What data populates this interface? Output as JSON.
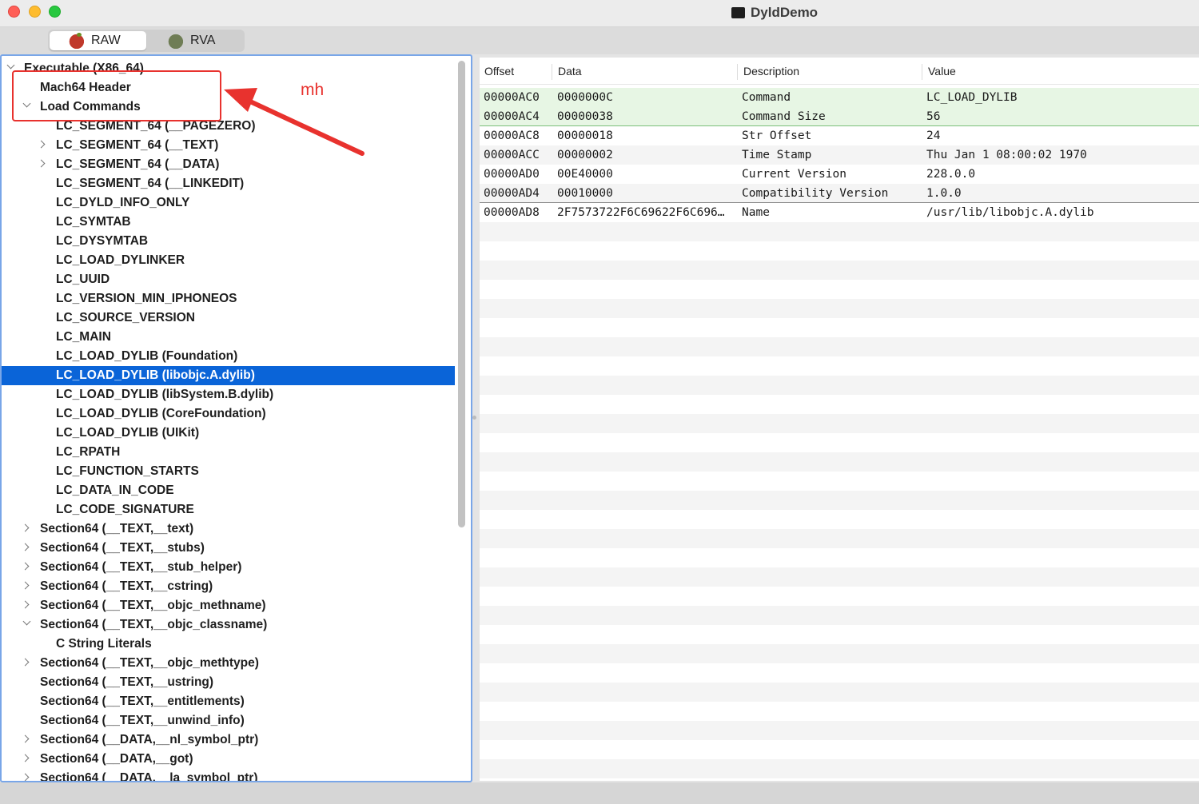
{
  "window": {
    "title": "DyldDemo"
  },
  "toolbar": {
    "modes": [
      {
        "label": "RAW",
        "icon": "apple-icon",
        "selected": true
      },
      {
        "label": "RVA",
        "icon": "bug-icon",
        "selected": false
      }
    ]
  },
  "tree": {
    "items": [
      {
        "label": "Executable  (X86_64)",
        "level": 0,
        "expander": "down",
        "selected": false
      },
      {
        "label": "Mach64 Header",
        "level": 1,
        "expander": "none",
        "selected": false
      },
      {
        "label": "Load Commands",
        "level": 1,
        "expander": "down",
        "selected": false
      },
      {
        "label": "LC_SEGMENT_64 (__PAGEZERO)",
        "level": 2,
        "expander": "none",
        "selected": false
      },
      {
        "label": "LC_SEGMENT_64 (__TEXT)",
        "level": 2,
        "expander": "right",
        "selected": false
      },
      {
        "label": "LC_SEGMENT_64 (__DATA)",
        "level": 2,
        "expander": "right",
        "selected": false
      },
      {
        "label": "LC_SEGMENT_64 (__LINKEDIT)",
        "level": 2,
        "expander": "none",
        "selected": false
      },
      {
        "label": "LC_DYLD_INFO_ONLY",
        "level": 2,
        "expander": "none",
        "selected": false
      },
      {
        "label": "LC_SYMTAB",
        "level": 2,
        "expander": "none",
        "selected": false
      },
      {
        "label": "LC_DYSYMTAB",
        "level": 2,
        "expander": "none",
        "selected": false
      },
      {
        "label": "LC_LOAD_DYLINKER",
        "level": 2,
        "expander": "none",
        "selected": false
      },
      {
        "label": "LC_UUID",
        "level": 2,
        "expander": "none",
        "selected": false
      },
      {
        "label": "LC_VERSION_MIN_IPHONEOS",
        "level": 2,
        "expander": "none",
        "selected": false
      },
      {
        "label": "LC_SOURCE_VERSION",
        "level": 2,
        "expander": "none",
        "selected": false
      },
      {
        "label": "LC_MAIN",
        "level": 2,
        "expander": "none",
        "selected": false
      },
      {
        "label": "LC_LOAD_DYLIB (Foundation)",
        "level": 2,
        "expander": "none",
        "selected": false
      },
      {
        "label": "LC_LOAD_DYLIB (libobjc.A.dylib)",
        "level": 2,
        "expander": "none",
        "selected": true
      },
      {
        "label": "LC_LOAD_DYLIB (libSystem.B.dylib)",
        "level": 2,
        "expander": "none",
        "selected": false
      },
      {
        "label": "LC_LOAD_DYLIB (CoreFoundation)",
        "level": 2,
        "expander": "none",
        "selected": false
      },
      {
        "label": "LC_LOAD_DYLIB (UIKit)",
        "level": 2,
        "expander": "none",
        "selected": false
      },
      {
        "label": "LC_RPATH",
        "level": 2,
        "expander": "none",
        "selected": false
      },
      {
        "label": "LC_FUNCTION_STARTS",
        "level": 2,
        "expander": "none",
        "selected": false
      },
      {
        "label": "LC_DATA_IN_CODE",
        "level": 2,
        "expander": "none",
        "selected": false
      },
      {
        "label": "LC_CODE_SIGNATURE",
        "level": 2,
        "expander": "none",
        "selected": false
      },
      {
        "label": "Section64 (__TEXT,__text)",
        "level": 1,
        "expander": "right",
        "selected": false
      },
      {
        "label": "Section64 (__TEXT,__stubs)",
        "level": 1,
        "expander": "right",
        "selected": false
      },
      {
        "label": "Section64 (__TEXT,__stub_helper)",
        "level": 1,
        "expander": "right",
        "selected": false
      },
      {
        "label": "Section64 (__TEXT,__cstring)",
        "level": 1,
        "expander": "right",
        "selected": false
      },
      {
        "label": "Section64 (__TEXT,__objc_methname)",
        "level": 1,
        "expander": "right",
        "selected": false
      },
      {
        "label": "Section64 (__TEXT,__objc_classname)",
        "level": 1,
        "expander": "down",
        "selected": false
      },
      {
        "label": "C String Literals",
        "level": 2,
        "expander": "none",
        "selected": false
      },
      {
        "label": "Section64 (__TEXT,__objc_methtype)",
        "level": 1,
        "expander": "right",
        "selected": false
      },
      {
        "label": "Section64 (__TEXT,__ustring)",
        "level": 1,
        "expander": "none",
        "selected": false
      },
      {
        "label": "Section64 (__TEXT,__entitlements)",
        "level": 1,
        "expander": "none",
        "selected": false
      },
      {
        "label": "Section64 (__TEXT,__unwind_info)",
        "level": 1,
        "expander": "none",
        "selected": false
      },
      {
        "label": "Section64 (__DATA,__nl_symbol_ptr)",
        "level": 1,
        "expander": "right",
        "selected": false
      },
      {
        "label": "Section64 (__DATA,__got)",
        "level": 1,
        "expander": "right",
        "selected": false
      },
      {
        "label": "Section64 (__DATA,__la_symbol_ptr)",
        "level": 1,
        "expander": "right",
        "selected": false
      }
    ]
  },
  "annotation": {
    "text": "mh",
    "color": "#e8322e"
  },
  "table": {
    "columns": [
      "Offset",
      "Data",
      "Description",
      "Value"
    ],
    "rows": [
      {
        "offset": "00000AC0",
        "data": "0000000C",
        "description": "Command",
        "value": "LC_LOAD_DYLIB",
        "highlight": true
      },
      {
        "offset": "00000AC4",
        "data": "00000038",
        "description": "Command Size",
        "value": "56",
        "highlight": true
      },
      {
        "offset": "00000AC8",
        "data": "00000018",
        "description": "Str Offset",
        "value": "24",
        "highlight": false
      },
      {
        "offset": "00000ACC",
        "data": "00000002",
        "description": "Time Stamp",
        "value": "Thu Jan  1 08:00:02 1970",
        "highlight": false
      },
      {
        "offset": "00000AD0",
        "data": "00E40000",
        "description": "Current Version",
        "value": "228.0.0",
        "highlight": false
      },
      {
        "offset": "00000AD4",
        "data": "00010000",
        "description": "Compatibility Version",
        "value": "1.0.0",
        "highlight": false
      },
      {
        "offset": "00000AD8",
        "data": "2F7573722F6C69622F6C696…",
        "description": "Name",
        "value": "/usr/lib/libobjc.A.dylib",
        "highlight": false
      }
    ]
  },
  "colors": {
    "selection": "#0a64d8",
    "row_highlight": "#e7f6e4",
    "focus_ring": "#79a6e8"
  }
}
